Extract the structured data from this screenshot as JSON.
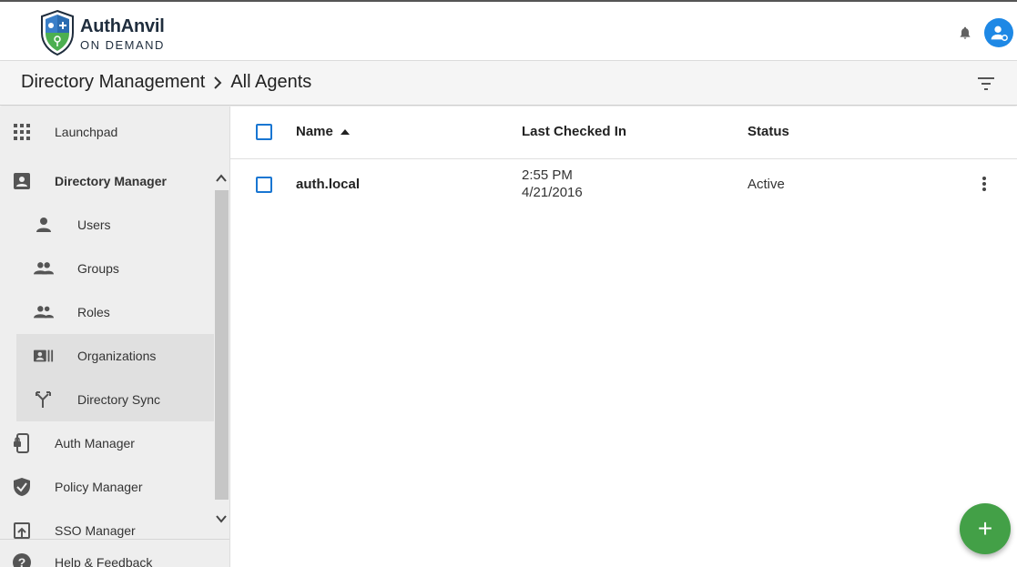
{
  "brand": {
    "name": "AuthAnvil",
    "subtitle": "ON DEMAND"
  },
  "header": {
    "breadcrumb": [
      "Directory Management",
      "All Agents"
    ]
  },
  "sidebar": {
    "items": [
      {
        "label": "Launchpad",
        "icon": "grid-icon"
      },
      {
        "label": "Directory Manager",
        "icon": "contact-card-icon"
      },
      {
        "label": "Users",
        "icon": "person-icon"
      },
      {
        "label": "Groups",
        "icon": "group-icon"
      },
      {
        "label": "Roles",
        "icon": "roles-icon"
      },
      {
        "label": "Organizations",
        "icon": "organization-icon"
      },
      {
        "label": "Directory Sync",
        "icon": "merge-arrow-icon"
      },
      {
        "label": "Auth Manager",
        "icon": "phone-lock-icon"
      },
      {
        "label": "Policy Manager",
        "icon": "shield-check-icon"
      },
      {
        "label": "SSO Manager",
        "icon": "open-in-icon"
      },
      {
        "label": "Help & Feedback",
        "icon": "help-icon"
      }
    ]
  },
  "table": {
    "columns": [
      "Name",
      "Last Checked In",
      "Status"
    ],
    "sort": {
      "column": "Name",
      "direction": "ascending"
    },
    "rows": [
      {
        "name": "auth.local",
        "time": "2:55 PM",
        "date": "4/21/2016",
        "status": "Active"
      }
    ]
  },
  "fab": {
    "label": "+"
  },
  "colors": {
    "accent": "#1976d2",
    "fab": "#43a047",
    "sidebar": "#eeeeee"
  }
}
